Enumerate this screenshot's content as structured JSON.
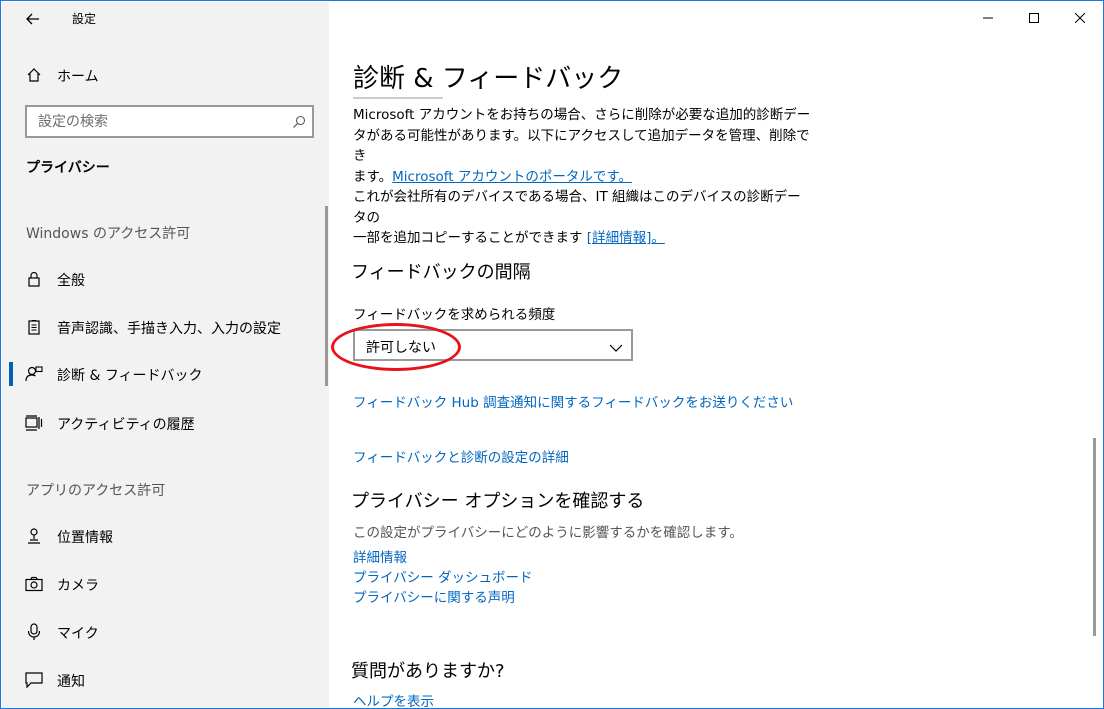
{
  "window": {
    "app_title": "設定",
    "back_icon": "arrow-left-icon",
    "minimize_icon": "minimize-icon",
    "maximize_icon": "maximize-icon",
    "close_icon": "close-icon",
    "accent_color": "#0063b1",
    "link_color": "#0067c0",
    "annotation_color": "#e8121b"
  },
  "sidebar": {
    "home_label": "ホーム",
    "search_placeholder": "設定の検索",
    "section_title": "プライバシー",
    "group_windows": "Windows のアクセス許可",
    "group_apps": "アプリのアクセス許可",
    "windows_items": [
      {
        "label": "全般",
        "icon": "lock-icon"
      },
      {
        "label": "音声認識、手描き入力、入力の設定",
        "icon": "speech-clipboard-icon"
      },
      {
        "label": "診断 & フィードバック",
        "icon": "feedback-person-icon",
        "selected": true
      },
      {
        "label": "アクティビティの履歴",
        "icon": "activity-history-icon"
      }
    ],
    "app_items": [
      {
        "label": "位置情報",
        "icon": "location-person-icon"
      },
      {
        "label": "カメラ",
        "icon": "camera-icon"
      },
      {
        "label": "マイク",
        "icon": "microphone-icon"
      },
      {
        "label": "通知",
        "icon": "notification-icon"
      }
    ]
  },
  "main": {
    "page_title": "診断 & フィードバック",
    "desc_line1": "Microsoft アカウントをお持ちの場合、さらに削除が必要な追加的診断デー",
    "desc_line2": "タがある可能性があります。以下にアクセスして追加データを管理、削除でき",
    "desc_line3_prefix": "ます。",
    "desc_line3_link": "Microsoft アカウントのポータルです。",
    "desc_line4": "これが会社所有のデバイスである場合、IT 組織はこのデバイスの診断データの",
    "desc_line5_prefix": "一部を追加コピーすることができます ",
    "desc_line5_link": "[詳細情報]。",
    "feedback_section_title": "フィードバックの間隔",
    "frequency_label": "フィードバックを求められる頻度",
    "frequency_value": "許可しない",
    "hub_link": "フィードバック Hub 調査通知に関するフィードバックをお送りください",
    "details_link": "フィードバックと診断の設定の詳細",
    "privacy_options_title": "プライバシー オプションを確認する",
    "privacy_options_text": "この設定がプライバシーにどのように影響するかを確認します。",
    "privacy_links": [
      "詳細情報",
      "プライバシー ダッシュボード",
      "プライバシーに関する声明"
    ],
    "question_title": "質問がありますか?",
    "help_link": "ヘルプを表示"
  }
}
